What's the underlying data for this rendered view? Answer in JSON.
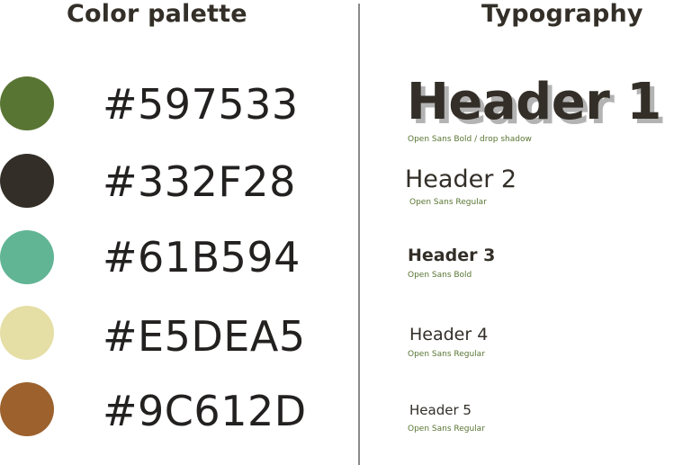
{
  "color_section": {
    "title": "Color palette",
    "swatches": [
      {
        "hex": "#597533",
        "color": "#597533"
      },
      {
        "hex": "#332F28",
        "color": "#332F28"
      },
      {
        "hex": "#61B594",
        "color": "#61B594"
      },
      {
        "hex": "#E5DEA5",
        "color": "#E5DEA5"
      },
      {
        "hex": "#9C612D",
        "color": "#9C612D"
      }
    ]
  },
  "typography_section": {
    "title": "Typography",
    "headers": [
      {
        "label": "Header 1",
        "note": "Open Sans Bold / drop shadow"
      },
      {
        "label": "Header 2",
        "note": "Open Sans Regular"
      },
      {
        "label": "Header 3",
        "note": "Open Sans Bold"
      },
      {
        "label": "Header 4",
        "note": "Open Sans Regular"
      },
      {
        "label": "Header 5",
        "note": "Open Sans Regular"
      }
    ]
  }
}
